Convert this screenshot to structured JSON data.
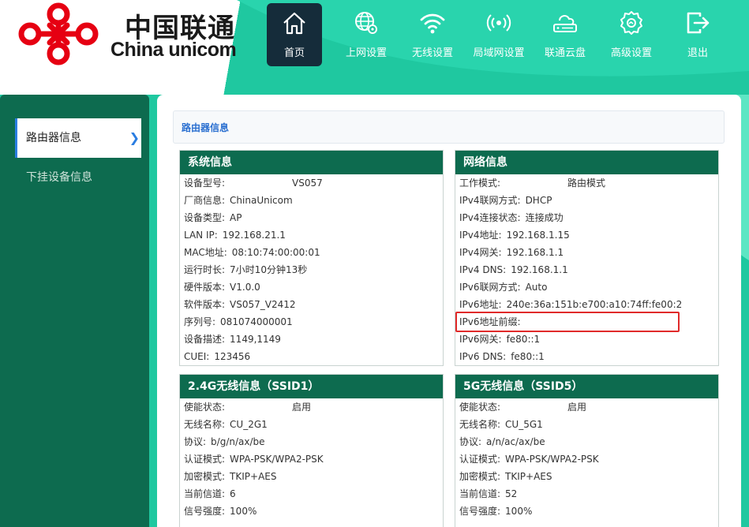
{
  "brand": {
    "name_cn": "中国联通",
    "name_en": "China unicom",
    "color": "#e60012"
  },
  "nav": [
    {
      "label": "首页",
      "icon": "home-icon",
      "active": true
    },
    {
      "label": "上网设置",
      "icon": "globe-gear-icon"
    },
    {
      "label": "无线设置",
      "icon": "wifi-icon"
    },
    {
      "label": "局域网设置",
      "icon": "lan-signal-icon"
    },
    {
      "label": "联通云盘",
      "icon": "cloud-drive-icon"
    },
    {
      "label": "高级设置",
      "icon": "gear-icon"
    },
    {
      "label": "退出",
      "icon": "logout-icon"
    }
  ],
  "sidebar": {
    "items": [
      {
        "label": "路由器信息",
        "active": true
      },
      {
        "label": "下挂设备信息"
      }
    ]
  },
  "breadcrumb": "路由器信息",
  "system": {
    "title": "系统信息",
    "rows": [
      {
        "k": "设备型号:",
        "v": "VS057"
      },
      {
        "k": "厂商信息:",
        "v": "ChinaUnicom"
      },
      {
        "k": "设备类型:",
        "v": "AP"
      },
      {
        "k": "LAN IP:",
        "v": "192.168.21.1"
      },
      {
        "k": "MAC地址:",
        "v": "08:10:74:00:00:01"
      },
      {
        "k": "运行时长:",
        "v": "7小时10分钟13秒"
      },
      {
        "k": "硬件版本:",
        "v": "V1.0.0"
      },
      {
        "k": "软件版本:",
        "v": "VS057_V2412"
      },
      {
        "k": "序列号:",
        "v": "081074000001"
      },
      {
        "k": "设备描述:",
        "v": "1149,1149"
      },
      {
        "k": "CUEI:",
        "v": "123456"
      }
    ]
  },
  "network": {
    "title": "网络信息",
    "rows": [
      {
        "k": "工作模式:",
        "v": "路由模式"
      },
      {
        "k": "IPv4联网方式:",
        "v": "DHCP"
      },
      {
        "k": "IPv4连接状态:",
        "v": "连接成功"
      },
      {
        "k": "IPv4地址:",
        "v": "192.168.1.15"
      },
      {
        "k": "IPv4网关:",
        "v": "192.168.1.1"
      },
      {
        "k": "IPv4 DNS:",
        "v": "192.168.1.1"
      },
      {
        "k": "IPv6联网方式:",
        "v": "Auto"
      },
      {
        "k": "IPv6地址:",
        "v": "240e:36a:151b:e700:a10:74ff:fe00:2"
      },
      {
        "k": "IPv6地址前缀:",
        "v": ""
      },
      {
        "k": "IPv6网关:",
        "v": "fe80::1"
      },
      {
        "k": "IPv6 DNS:",
        "v": "fe80::1"
      }
    ]
  },
  "wifi24": {
    "title": "2.4G无线信息（SSID1）",
    "rows": [
      {
        "k": "使能状态:",
        "v": "启用"
      },
      {
        "k": "无线名称:",
        "v": "CU_2G1"
      },
      {
        "k": "协议:",
        "v": "b/g/n/ax/be"
      },
      {
        "k": "认证模式:",
        "v": "WPA-PSK/WPA2-PSK"
      },
      {
        "k": "加密模式:",
        "v": "TKIP+AES"
      },
      {
        "k": "当前信道:",
        "v": "6"
      },
      {
        "k": "信号强度:",
        "v": "100%"
      }
    ]
  },
  "wifi5": {
    "title": "5G无线信息（SSID5）",
    "rows": [
      {
        "k": "使能状态:",
        "v": "启用"
      },
      {
        "k": "无线名称:",
        "v": "CU_5G1"
      },
      {
        "k": "协议:",
        "v": "a/n/ac/ax/be"
      },
      {
        "k": "认证模式:",
        "v": "WPA-PSK/WPA2-PSK"
      },
      {
        "k": "加密模式:",
        "v": "TKIP+AES"
      },
      {
        "k": "当前信道:",
        "v": "52"
      },
      {
        "k": "信号强度:",
        "v": "100%"
      }
    ]
  }
}
